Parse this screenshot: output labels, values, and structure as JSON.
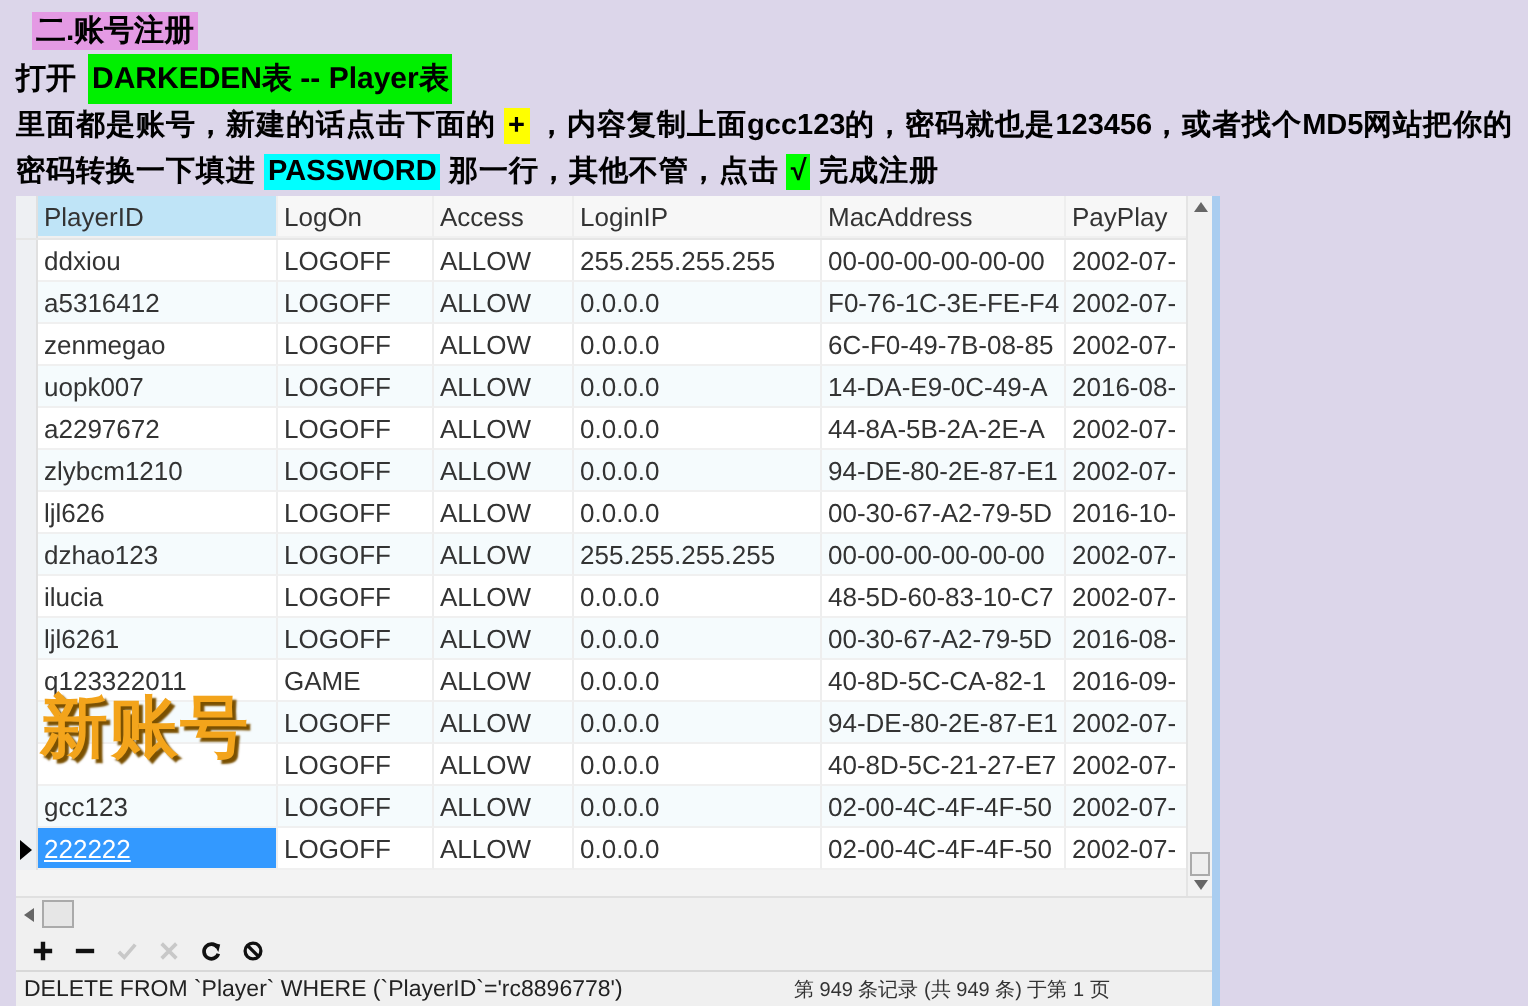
{
  "heading": "二.账号注册",
  "open_line": {
    "prefix": "打开",
    "table_name": "DARKEDEN表 --  Player表"
  },
  "instruction": [
    {
      "text": "里面都是账号，新建的话点击下面的 "
    },
    {
      "text": "+",
      "color": "#ffff00"
    },
    {
      "text": " ，内容复制上面gcc123的，密码就也是123456，或者找个MD5网站把你的密码转换一下填进 "
    },
    {
      "text": "PASSWORD",
      "color": "#00ffff"
    },
    {
      "text": " 那一行，其他不管，点击 "
    },
    {
      "text": "√",
      "color": "#00ff00"
    },
    {
      "text": " 完成注册"
    }
  ],
  "table": {
    "columns": [
      {
        "label": "PlayerID",
        "selected": true
      },
      {
        "label": "LogOn",
        "selected": false
      },
      {
        "label": "Access",
        "selected": false
      },
      {
        "label": "LoginIP",
        "selected": false
      },
      {
        "label": "MacAddress",
        "selected": false
      },
      {
        "label": "PayPlay",
        "selected": false
      }
    ],
    "rows": [
      {
        "cells": [
          "ddxiou",
          "LOGOFF",
          "ALLOW",
          "255.255.255.255",
          "00-00-00-00-00-00",
          "2002-07-"
        ],
        "selected": false
      },
      {
        "cells": [
          "a5316412",
          "LOGOFF",
          "ALLOW",
          "0.0.0.0",
          "F0-76-1C-3E-FE-F4",
          "2002-07-"
        ],
        "selected": false
      },
      {
        "cells": [
          "zenmegao",
          "LOGOFF",
          "ALLOW",
          "0.0.0.0",
          "6C-F0-49-7B-08-85",
          "2002-07-"
        ],
        "selected": false
      },
      {
        "cells": [
          "uopk007",
          "LOGOFF",
          "ALLOW",
          "0.0.0.0",
          "14-DA-E9-0C-49-A",
          "2016-08-"
        ],
        "selected": false
      },
      {
        "cells": [
          "a2297672",
          "LOGOFF",
          "ALLOW",
          "0.0.0.0",
          "44-8A-5B-2A-2E-A",
          "2002-07-"
        ],
        "selected": false
      },
      {
        "cells": [
          "zlybcm1210",
          "LOGOFF",
          "ALLOW",
          "0.0.0.0",
          "94-DE-80-2E-87-E1",
          "2002-07-"
        ],
        "selected": false
      },
      {
        "cells": [
          "ljl626",
          "LOGOFF",
          "ALLOW",
          "0.0.0.0",
          "00-30-67-A2-79-5D",
          "2016-10-"
        ],
        "selected": false
      },
      {
        "cells": [
          "dzhao123",
          "LOGOFF",
          "ALLOW",
          "255.255.255.255",
          "00-00-00-00-00-00",
          "2002-07-"
        ],
        "selected": false
      },
      {
        "cells": [
          "ilucia",
          "LOGOFF",
          "ALLOW",
          "0.0.0.0",
          "48-5D-60-83-10-C7",
          "2002-07-"
        ],
        "selected": false
      },
      {
        "cells": [
          "ljl6261",
          "LOGOFF",
          "ALLOW",
          "0.0.0.0",
          "00-30-67-A2-79-5D",
          "2016-08-"
        ],
        "selected": false
      },
      {
        "cells": [
          "q123322011",
          "GAME",
          "ALLOW",
          "0.0.0.0",
          "40-8D-5C-CA-82-1",
          "2016-09-"
        ],
        "selected": false
      },
      {
        "cells": [
          "",
          "LOGOFF",
          "ALLOW",
          "0.0.0.0",
          "94-DE-80-2E-87-E1",
          "2002-07-"
        ],
        "selected": false
      },
      {
        "cells": [
          "",
          "LOGOFF",
          "ALLOW",
          "0.0.0.0",
          "40-8D-5C-21-27-E7",
          "2002-07-"
        ],
        "selected": false
      },
      {
        "cells": [
          "gcc123",
          "LOGOFF",
          "ALLOW",
          "0.0.0.0",
          "02-00-4C-4F-4F-50",
          "2002-07-"
        ],
        "selected": false
      },
      {
        "cells": [
          "222222",
          "LOGOFF",
          "ALLOW",
          "0.0.0.0",
          "02-00-4C-4F-4F-50",
          "2002-07-"
        ],
        "selected": true
      }
    ]
  },
  "overlay_label": "新账号",
  "toolbar": [
    {
      "kind": "add",
      "disabled": false
    },
    {
      "kind": "remove",
      "disabled": false
    },
    {
      "kind": "apply",
      "disabled": true
    },
    {
      "kind": "cancel",
      "disabled": true
    },
    {
      "kind": "refresh",
      "disabled": false
    },
    {
      "kind": "stop",
      "disabled": false
    }
  ],
  "status_bar": {
    "query": "DELETE FROM `Player` WHERE (`PlayerID`='rc8896778')",
    "record_info": "第 949 条记录 (共 949 条) 于第 1 页"
  }
}
